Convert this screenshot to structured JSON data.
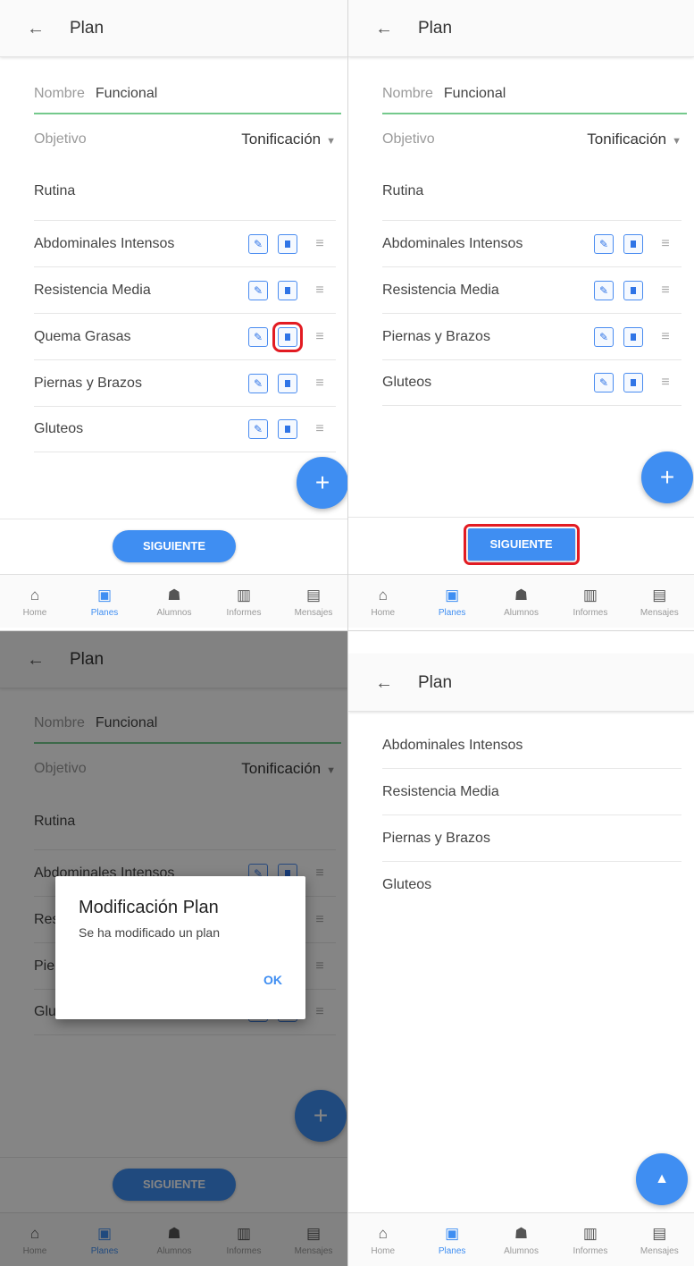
{
  "appbar": {
    "title": "Plan",
    "back_icon": "arrow-left-icon"
  },
  "form": {
    "nombre_label": "Nombre",
    "nombre_value": "Funcional",
    "objetivo_label": "Objetivo",
    "objetivo_value": "Tonificación",
    "rutina_header": "Rutina"
  },
  "routines_before": [
    "Abdominales Intensos",
    "Resistencia Media",
    "Quema Grasas",
    "Piernas y Brazos",
    "Gluteos"
  ],
  "routines_after": [
    "Abdominales Intensos",
    "Resistencia Media",
    "Piernas y Brazos",
    "Gluteos"
  ],
  "buttons": {
    "siguiente": "SIGUIENTE",
    "fab_add": "+",
    "fab_up": "▲"
  },
  "dialog": {
    "title": "Modificación Plan",
    "message": "Se ha modificado un plan",
    "ok": "OK"
  },
  "nav": [
    {
      "label": "Home",
      "icon": "home-icon",
      "active": false
    },
    {
      "label": "Planes",
      "icon": "clipboard-icon",
      "active": true
    },
    {
      "label": "Alumnos",
      "icon": "people-icon",
      "active": false
    },
    {
      "label": "Informes",
      "icon": "bar-chart-icon",
      "active": false
    },
    {
      "label": "Mensajes",
      "icon": "chat-icon",
      "active": false
    }
  ],
  "colors": {
    "accent": "#3f8ef2",
    "highlight": "#e21b22",
    "underline": "#74c98c"
  }
}
